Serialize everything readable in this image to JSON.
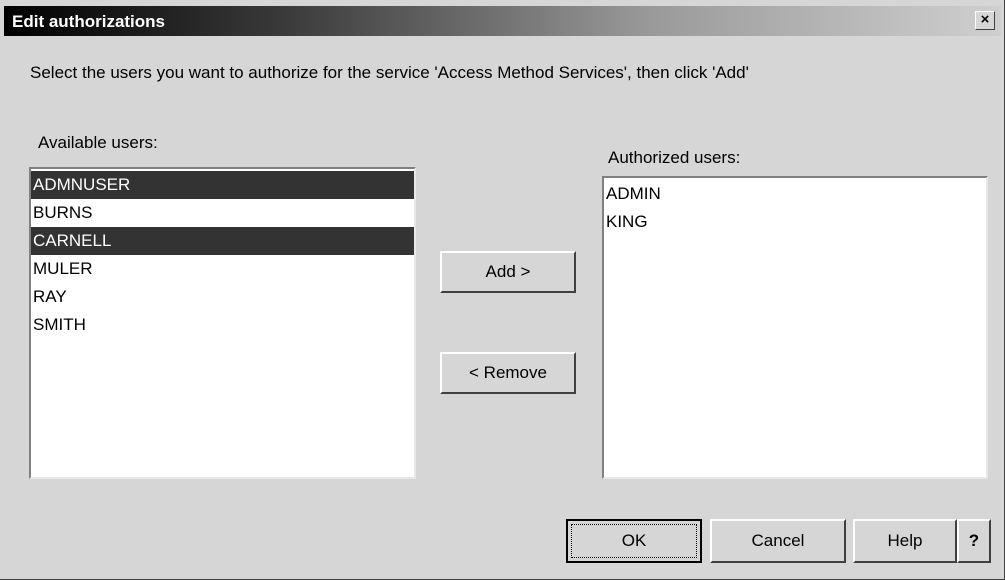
{
  "window": {
    "title": "Edit authorizations",
    "close_label": "×"
  },
  "instruction": "Select the users you want to authorize for the service 'Access Method Services', then click 'Add'",
  "available": {
    "label": "Available users:",
    "items": [
      {
        "name": "ADMNUSER",
        "selected": true
      },
      {
        "name": "BURNS",
        "selected": false
      },
      {
        "name": "CARNELL",
        "selected": true
      },
      {
        "name": "MULER",
        "selected": false
      },
      {
        "name": "RAY",
        "selected": false
      },
      {
        "name": "SMITH",
        "selected": false
      }
    ]
  },
  "authorized": {
    "label": "Authorized users:",
    "items": [
      "ADMIN",
      "KING"
    ]
  },
  "buttons": {
    "add": "Add >",
    "remove": "< Remove",
    "ok": "OK",
    "cancel": "Cancel",
    "help": "Help",
    "question": "?"
  }
}
